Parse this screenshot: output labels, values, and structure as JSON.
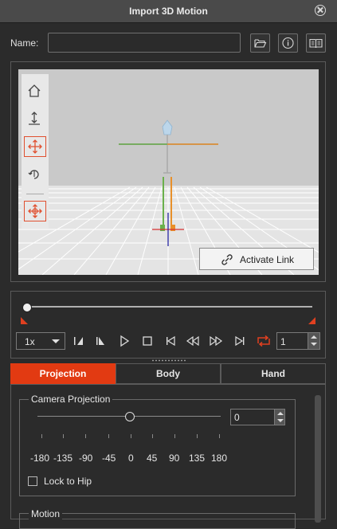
{
  "window": {
    "title": "Import 3D Motion"
  },
  "name_field": {
    "label": "Name:",
    "value": ""
  },
  "header_buttons": [
    {
      "name": "open-folder-button",
      "icon": "folder-open-icon"
    },
    {
      "name": "info-button",
      "icon": "info-icon"
    },
    {
      "name": "manual-button",
      "icon": "book-icon"
    }
  ],
  "viewport": {
    "background_color": "#c9c9c9",
    "tools": [
      "home-icon",
      "move-vertical-icon",
      "move-icon",
      "rotate-icon",
      "pan-icon"
    ],
    "activate_link_label": "Activate Link"
  },
  "playback": {
    "speed": "1x",
    "frame": "1",
    "accent_color": "#e04020"
  },
  "tabs": [
    {
      "label": "Projection",
      "active": true
    },
    {
      "label": "Body",
      "active": false
    },
    {
      "label": "Hand",
      "active": false
    }
  ],
  "camera_projection": {
    "title": "Camera Projection",
    "value": "0",
    "ticks": [
      "-180",
      "-135",
      "-90",
      "-45",
      "0",
      "45",
      "90",
      "135",
      "180"
    ],
    "lock_to_hip_label": "Lock to Hip",
    "lock_to_hip_checked": false
  },
  "motion_group": {
    "title": "Motion"
  }
}
